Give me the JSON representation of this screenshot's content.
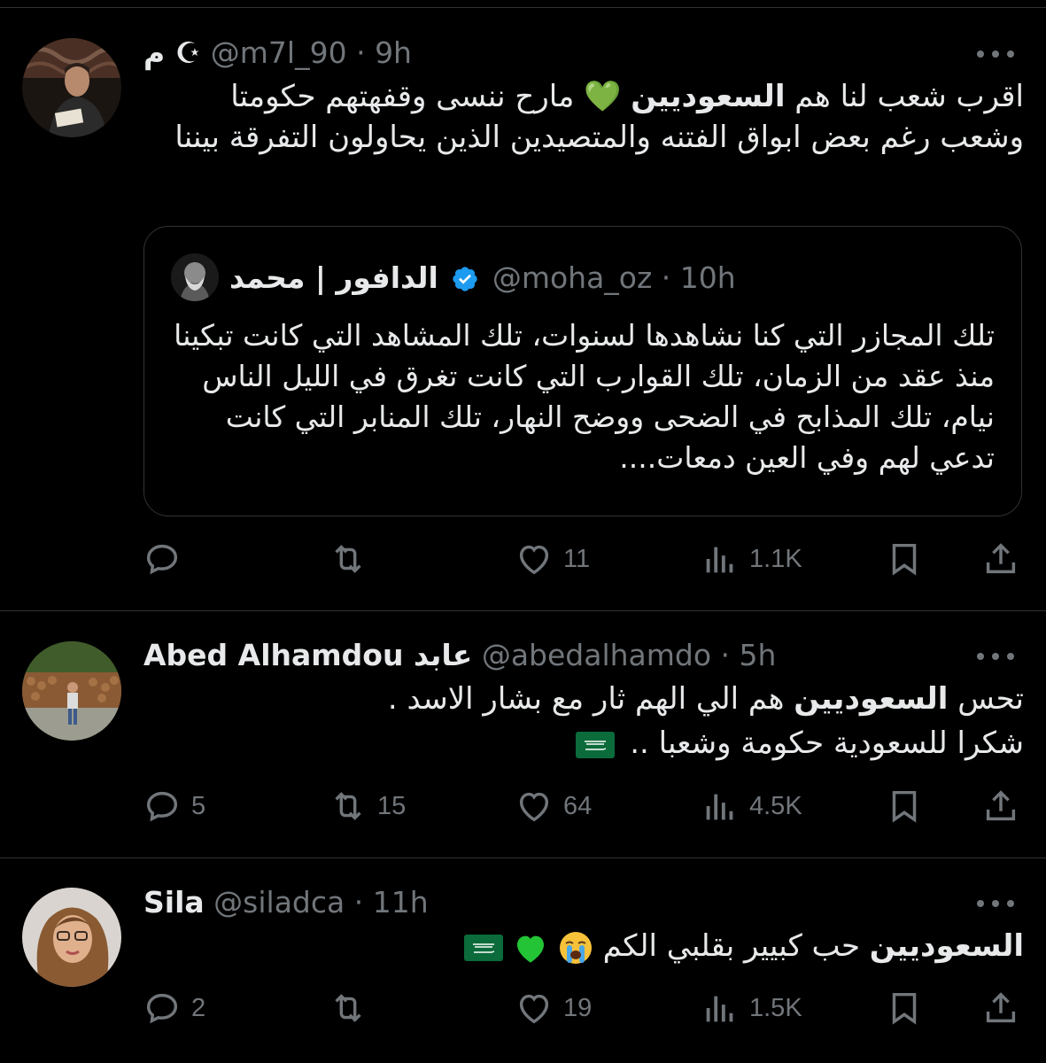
{
  "colors": {
    "background": "#000000",
    "text": "#e7e9ea",
    "muted": "#71767b",
    "divider": "#2f3336",
    "verified": "#1d9bf0",
    "green_heart": "#23c435",
    "saudi_green": "#0b6b3a"
  },
  "tweets": [
    {
      "author_name": "م ☪",
      "handle": "@m7l_90",
      "time": "9h",
      "text_parts": [
        "اقرب شعب لنا هم ",
        "السعوديين",
        " 💚 مارح ننسى وقفهتهم حكومتا وشعب رغم بعض ابواق الفتنه والمتصيدين الذين يحاولون التفرقة بيننا"
      ],
      "quote": {
        "author_name": "الدافور | محمد",
        "verified_icon": "verified-badge-icon",
        "handle": "@moha_oz",
        "time": "10h",
        "text": "تلك المجازر التي كنا نشاهدها لسنوات، تلك المشاهد التي كانت تبكينا منذ عقد من الزمان، تلك القوارب التي كانت تغرق في الليل الناس نيام، تلك المذابح في الضحى ووضح النهار، تلك المنابر التي كانت تدعي لهم وفي العين دمعات...."
      },
      "actions": {
        "replies": "",
        "retweets": "",
        "likes": "11",
        "views": "1.1K"
      }
    },
    {
      "author_name": "Abed Alhamdou عابد",
      "handle": "@abedalhamdo",
      "time": "5h",
      "line1_parts": [
        "تحس ",
        "السعوديين",
        " هم الي الهم ثار مع بشار الاسد ."
      ],
      "line2": "شكرا للسعودية حكومة وشعبا ..",
      "actions": {
        "replies": "5",
        "retweets": "15",
        "likes": "64",
        "views": "4.5K"
      }
    },
    {
      "author_name": "Sila",
      "handle": "@siladca",
      "time": "11h",
      "text_parts": [
        "السعوديين",
        " حب كبيير بقلبي الكم "
      ],
      "actions": {
        "replies": "2",
        "retweets": "",
        "likes": "19",
        "views": "1.5K"
      }
    }
  ],
  "separator": " · "
}
